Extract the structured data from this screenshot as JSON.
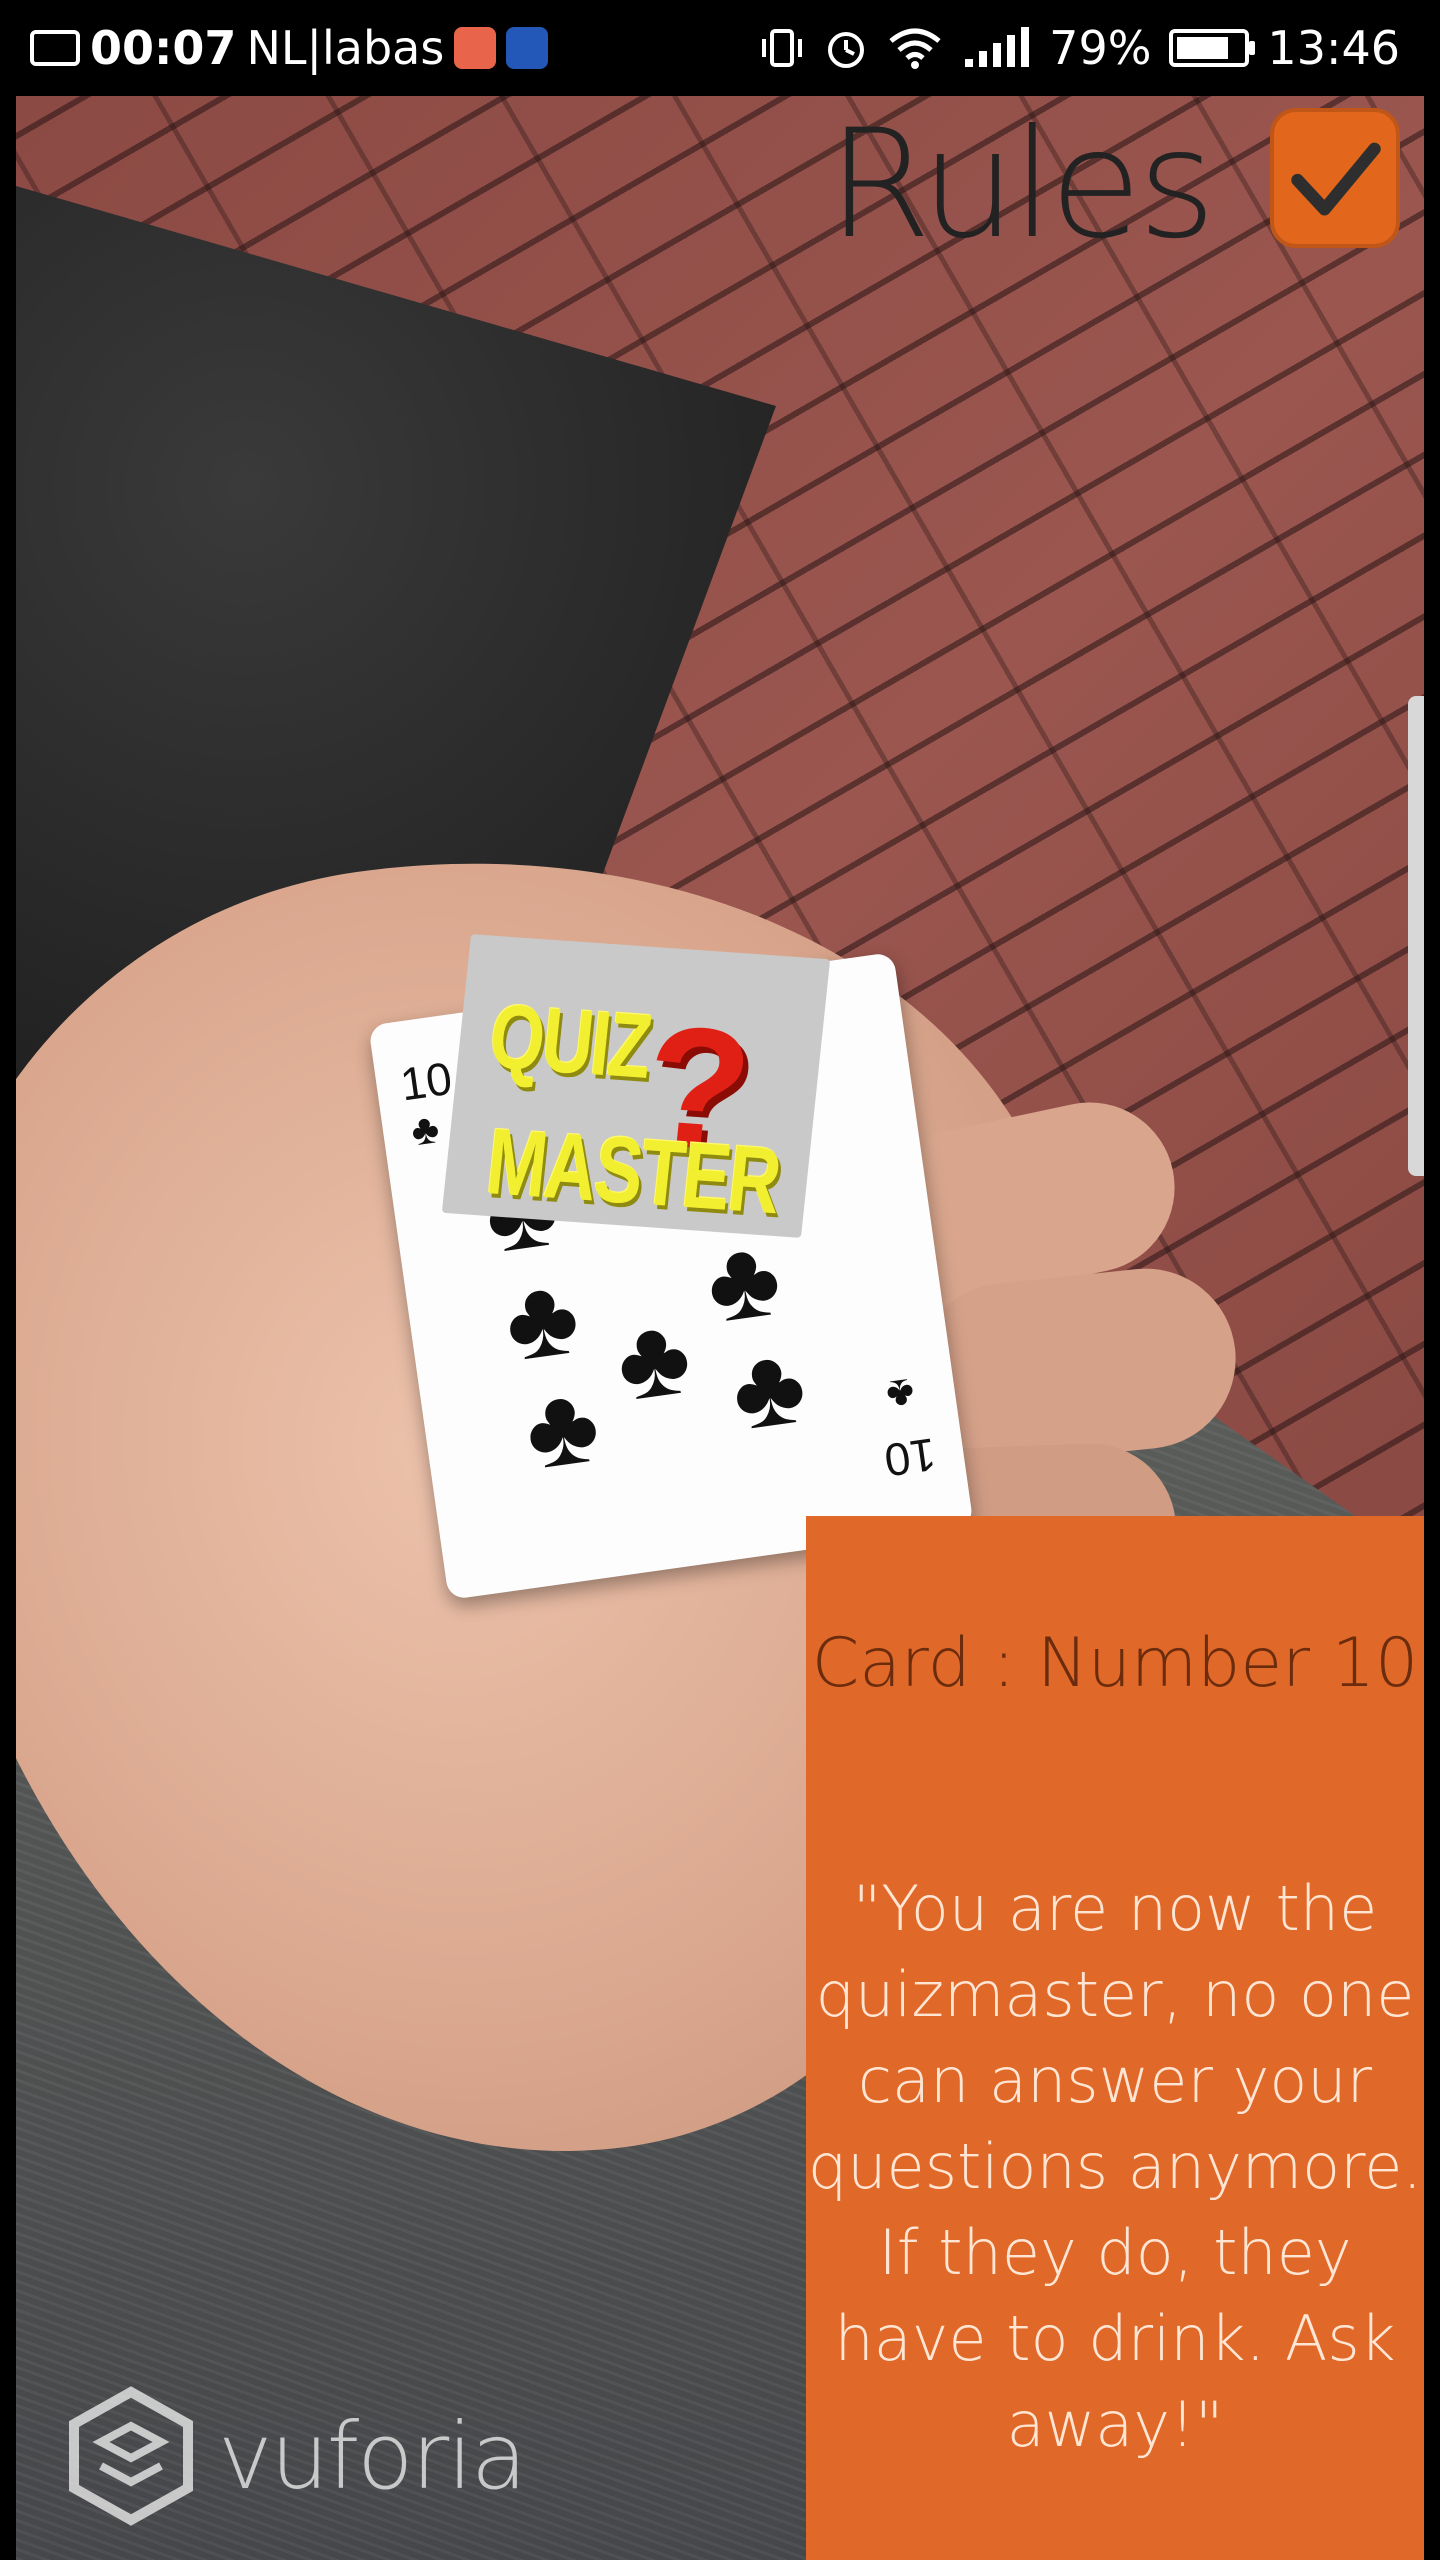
{
  "status_bar": {
    "left_time": "00:07",
    "carrier": "NL|labas",
    "battery_percent": "79%",
    "clock": "13:46"
  },
  "rules": {
    "label": "Rules",
    "checked": true,
    "accent_color": "#e2661c"
  },
  "card_info": {
    "title": "Card : Number 10",
    "description": "\"You are now the quizmaster, no one can answer your questions anymore. If they do, they have to drink. Ask away!\""
  },
  "ar_card": {
    "line1": "QUIZ",
    "line2": "MASTER",
    "symbol": "?"
  },
  "playing_card": {
    "rank": "10",
    "suit_symbol": "♣"
  },
  "watermark": {
    "text": "vuforia"
  }
}
